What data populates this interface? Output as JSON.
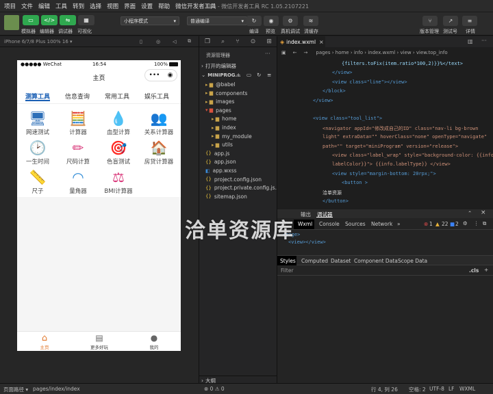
{
  "menu": {
    "items": [
      "项目",
      "文件",
      "编辑",
      "工具",
      "转到",
      "选择",
      "视图",
      "界面",
      "设置",
      "帮助",
      "微信开发者工具"
    ],
    "title": "888 - 微信开发者工具 RC 1.05.2107221"
  },
  "toolbar": {
    "simulator": "模拟器",
    "editor": "编辑器",
    "debugger": "调试器",
    "visual": "可视化",
    "mode": "小程序模式",
    "compile_mode": "普通编译",
    "compile": "编译",
    "preview": "预览",
    "real_debug": "真机调试",
    "clear_cache": "清缓存",
    "version": "版本管理",
    "test": "测试号",
    "details": "详情"
  },
  "sim": {
    "device": "iPhone 6/7/8 Plus 100% 16 ▾"
  },
  "phone": {
    "status_left": "●●●●● WeChat",
    "time": "16:54",
    "battery": "100%",
    "nav_title": "主页",
    "categories": [
      "测算工具",
      "信息查询",
      "常用工具",
      "娱乐工具"
    ],
    "tiles": [
      {
        "icon": "🖥",
        "label": "网速测试",
        "color": "#2d6fb8"
      },
      {
        "icon": "🧮",
        "label": "计算器",
        "color": "#e27a2e"
      },
      {
        "icon": "💧",
        "label": "血型计算",
        "color": "#d9387a"
      },
      {
        "icon": "👥",
        "label": "关系计算器",
        "color": "#d9387a"
      },
      {
        "icon": "🕑",
        "label": "一生时间",
        "color": "#2d8ad6"
      },
      {
        "icon": "✏",
        "label": "尺码计算",
        "color": "#d9387a"
      },
      {
        "icon": "🎯",
        "label": "色盲测试",
        "color": "#2d6fb8"
      },
      {
        "icon": "🏠",
        "label": "房贷计算器",
        "color": "#1a3d8a"
      },
      {
        "icon": "📏",
        "label": "尺子",
        "color": "#2d8ad6"
      },
      {
        "icon": "◠",
        "label": "量角器",
        "color": "#2d8ad6"
      },
      {
        "icon": "⚖",
        "label": "BMI计算器",
        "color": "#d9387a"
      }
    ],
    "tabbar": [
      "主页",
      "更多好玩",
      "我的"
    ]
  },
  "explorer": {
    "title": "资源管理器",
    "open_editors": "打开的编辑器",
    "project": "MINIPROG...",
    "items": [
      {
        "label": "@babel",
        "icon": "folder",
        "depth": 1
      },
      {
        "label": "components",
        "icon": "folder",
        "depth": 1
      },
      {
        "label": "images",
        "icon": "folder",
        "depth": 1
      },
      {
        "label": "pages",
        "icon": "folder-open",
        "depth": 1
      },
      {
        "label": "home",
        "icon": "folder",
        "depth": 2
      },
      {
        "label": "index",
        "icon": "folder",
        "depth": 2
      },
      {
        "label": "my_module",
        "icon": "folder",
        "depth": 2
      },
      {
        "label": "utils",
        "icon": "folder",
        "depth": 2
      },
      {
        "label": "app.js",
        "icon": "js",
        "depth": 1
      },
      {
        "label": "app.json",
        "icon": "json",
        "depth": 1
      },
      {
        "label": "app.wxss",
        "icon": "wxss",
        "depth": 1
      },
      {
        "label": "project.config.json",
        "icon": "json",
        "depth": 1
      },
      {
        "label": "project.private.config.js...",
        "icon": "json",
        "depth": 1
      },
      {
        "label": "sitemap.json",
        "icon": "json",
        "depth": 1
      }
    ],
    "outline": "大纲"
  },
  "editor": {
    "tab": "index.wxml",
    "breadcrumb": "pages › home › info › index.wxml › view › view.top_info",
    "lines": [
      {
        "n": "",
        "t": "{filters.toFix(item.ratio*100,2)}}%</text>",
        "c": "#9cdcfe",
        "i": 3
      },
      {
        "n": "",
        "t": "</view>",
        "c": "#569cd6",
        "i": 2
      },
      {
        "n": "",
        "t": "<view class=\"line\"></view>",
        "c": "#569cd6",
        "i": 2
      },
      {
        "n": "",
        "t": "</block>",
        "c": "#569cd6",
        "i": 1
      },
      {
        "n": "",
        "t": "</view>",
        "c": "#569cd6",
        "i": 0
      },
      {
        "n": "",
        "t": "",
        "c": "#ccc",
        "i": 0
      },
      {
        "n": "",
        "t": "<view class=\"tool_list\">",
        "c": "#569cd6",
        "i": 0
      },
      {
        "n": "",
        "t": "<navigator appId=\"修改成自己的ID\" class=\"nav-li bg-brown",
        "c": "#ce9178",
        "i": 1
      },
      {
        "n": "",
        "t": "light\" extraData=\"\" hoverClass=\"none\" openType=\"navigate\"",
        "c": "#ce9178",
        "i": 1
      },
      {
        "n": "",
        "t": "path=\"\" target=\"miniProgram\" version=\"release\">",
        "c": "#ce9178",
        "i": 1
      },
      {
        "n": "",
        "t": "<view class=\"label_wrap\" style=\"background-color: {{info.",
        "c": "#ce9178",
        "i": 2
      },
      {
        "n": "",
        "t": "labelColor}}\"> {{info.labelType}} </view>",
        "c": "#ce9178",
        "i": 2
      },
      {
        "n": "",
        "t": "<view style=\"margin-bottom: 20rpx;\">",
        "c": "#569cd6",
        "i": 2
      },
      {
        "n": "",
        "t": "<button >",
        "c": "#569cd6",
        "i": 3
      },
      {
        "n": "",
        "t": "洽单资源",
        "c": "#dddddd",
        "i": 1
      },
      {
        "n": "",
        "t": "</button>",
        "c": "#569cd6",
        "i": 1
      }
    ]
  },
  "devtools": {
    "top_tabs": [
      "输出",
      "调试器"
    ],
    "tabs": [
      "Wxml",
      "Console",
      "Sources",
      "Network",
      "»"
    ],
    "errors": "1",
    "warnings": "22",
    "info": "2",
    "tree": [
      "<page>",
      "<view></view>"
    ],
    "style_tabs": [
      "Styles",
      "Computed",
      "Dataset",
      "Component Data",
      "Scope Data"
    ],
    "filter": "Filter",
    "cls": ".cls"
  },
  "status": {
    "path_label": "页面路径 ▾",
    "path": "pages/index/index",
    "problems": "⊗ 0 ⚠ 0",
    "pos": "行 4, 列 26",
    "spaces": "空格: 2",
    "enc": "UTF-8",
    "eol": "LF",
    "lang": "WXML"
  },
  "watermark": "洽单资源库"
}
